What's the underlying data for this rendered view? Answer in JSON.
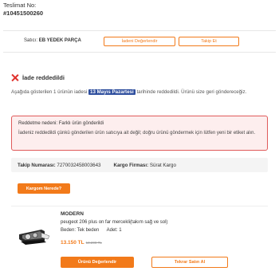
{
  "delivery": {
    "label": "Teslimat No:",
    "number": "#10451500260"
  },
  "seller": {
    "prefix": "Satıcı:",
    "name": "EB YEDEK PARÇA",
    "rate_button": "İadeni Değerlendir",
    "follow_button": "Takip Et"
  },
  "status": {
    "title": "İade reddedildi"
  },
  "description": {
    "before": "Aşağıda gösterilen 1 ürünün iadesi ",
    "date": "13 Mayıs Pazartesi",
    "after": " tarihinde reddedildi. Ürünü size geri göndereceğiz."
  },
  "reason": {
    "line1": "Reddetme nedeni: Farklı ürün gönderildi",
    "line2": "İadeniz reddedildi çünkü gönderilen ürün satıcıya ait değil; doğru ürünü göndermek için lütfen yeni bir etiket alın."
  },
  "tracking": {
    "number_label": "Takip Numarası:",
    "number": "7270032458003643",
    "carrier_label": "Kargo Firması:",
    "carrier": "Sürat Kargo"
  },
  "where_button": "Kargom Nerede?",
  "product": {
    "brand": "MODERN",
    "name": "peugeot 206 plus on far mercekli(takım sağ ve sol)",
    "size": "Beden: Tek beden",
    "quantity": "Adet: 1",
    "price": "13.150 TL",
    "old_price": "13.200 TL",
    "rate_button": "Ürünü Değerlendir",
    "rebuy_button": "Tekrar Satın Al"
  },
  "colors": {
    "accent": "#f27a1a",
    "reject": "#e0312c",
    "date_chip": "#2f4f9e"
  },
  "icons": {
    "status": "x-icon",
    "product_image": "headlight-image"
  }
}
